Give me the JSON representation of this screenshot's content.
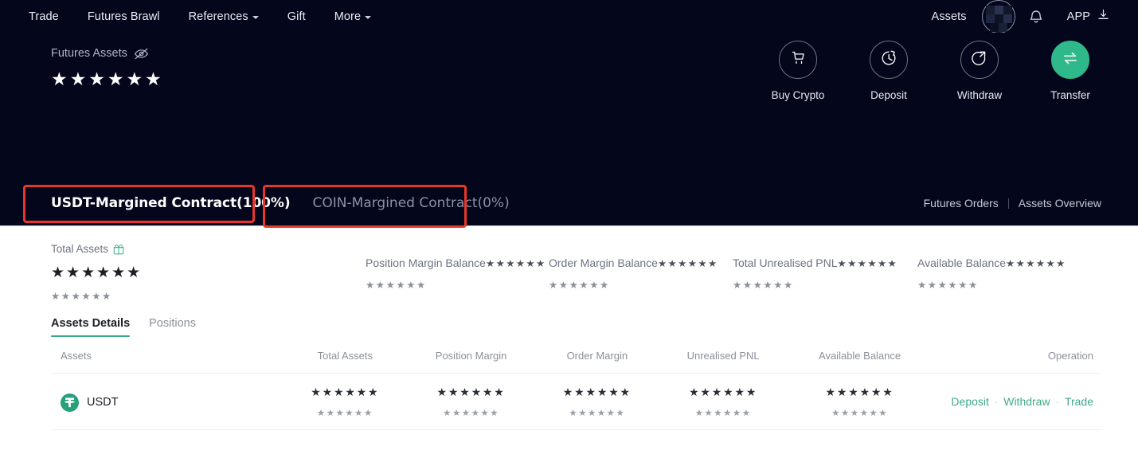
{
  "nav": {
    "left_items": [
      {
        "label": "Trade",
        "caret": false,
        "name": "nav-trade"
      },
      {
        "label": "Futures Brawl",
        "caret": false,
        "name": "nav-futures-brawl"
      },
      {
        "label": "References",
        "caret": true,
        "name": "nav-references"
      },
      {
        "label": "Gift",
        "caret": false,
        "name": "nav-gift"
      },
      {
        "label": "More",
        "caret": true,
        "name": "nav-more"
      }
    ],
    "assets_label": "Assets",
    "app_label": "APP",
    "icons": {
      "avatar": "user-avatar",
      "bell": "notification-bell-icon",
      "download": "download-icon"
    }
  },
  "hero": {
    "futures_assets_label": "Futures Assets",
    "eye_icon": "eye-off-icon",
    "futures_assets_value": "★★★★★★",
    "actions": [
      {
        "label": "Buy Crypto",
        "icon": "shopping-cart-icon",
        "filled": false
      },
      {
        "label": "Deposit",
        "icon": "deposit-arrow-icon",
        "filled": false
      },
      {
        "label": "Withdraw",
        "icon": "withdraw-arrow-icon",
        "filled": false
      },
      {
        "label": "Transfer",
        "icon": "transfer-arrows-icon",
        "filled": true
      }
    ],
    "contract_tabs": [
      {
        "label": "USDT-Margined Contract(100%)",
        "active": true
      },
      {
        "label": "COIN-Margined Contract(0%)",
        "active": false
      }
    ],
    "links": [
      {
        "label": "Futures Orders"
      },
      {
        "label": "Assets Overview"
      }
    ]
  },
  "summary": {
    "total_assets_label": "Total Assets",
    "gift_icon": "gift-box-icon",
    "total_assets_value": "★★★★★★",
    "total_assets_sub": "★★★★★★",
    "stats": [
      {
        "label": "Position Margin Balance",
        "value": "★★★★★★",
        "sub": "★★★★★★"
      },
      {
        "label": "Order Margin Balance",
        "value": "★★★★★★",
        "sub": "★★★★★★"
      },
      {
        "label": "Total Unrealised PNL",
        "value": "★★★★★★",
        "sub": "★★★★★★"
      },
      {
        "label": "Available Balance",
        "value": "★★★★★★",
        "sub": "★★★★★★"
      }
    ]
  },
  "detail_tabs": [
    {
      "label": "Assets Details",
      "active": true
    },
    {
      "label": "Positions",
      "active": false
    }
  ],
  "table": {
    "headers": [
      "Assets",
      "Total Assets",
      "Position Margin",
      "Order Margin",
      "Unrealised PNL",
      "Available Balance",
      "Operation"
    ],
    "rows": [
      {
        "asset": "USDT",
        "asset_icon": "usdt-coin-icon",
        "total_assets": "★★★★★★",
        "total_assets_sub": "★★★★★★",
        "position_margin": "★★★★★★",
        "position_margin_sub": "★★★★★★",
        "order_margin": "★★★★★★",
        "order_margin_sub": "★★★★★★",
        "unrealised_pnl": "★★★★★★",
        "unrealised_pnl_sub": "★★★★★★",
        "available_balance": "★★★★★★",
        "available_balance_sub": "★★★★★★",
        "ops": [
          "Deposit",
          "Withdraw",
          "Trade"
        ]
      }
    ]
  },
  "colors": {
    "dark_bg": "#04061b",
    "accent_green": "#2fb98a",
    "link_green": "#3fa98a",
    "annotation_red": "#e8372a",
    "muted_text": "#8b9099"
  }
}
